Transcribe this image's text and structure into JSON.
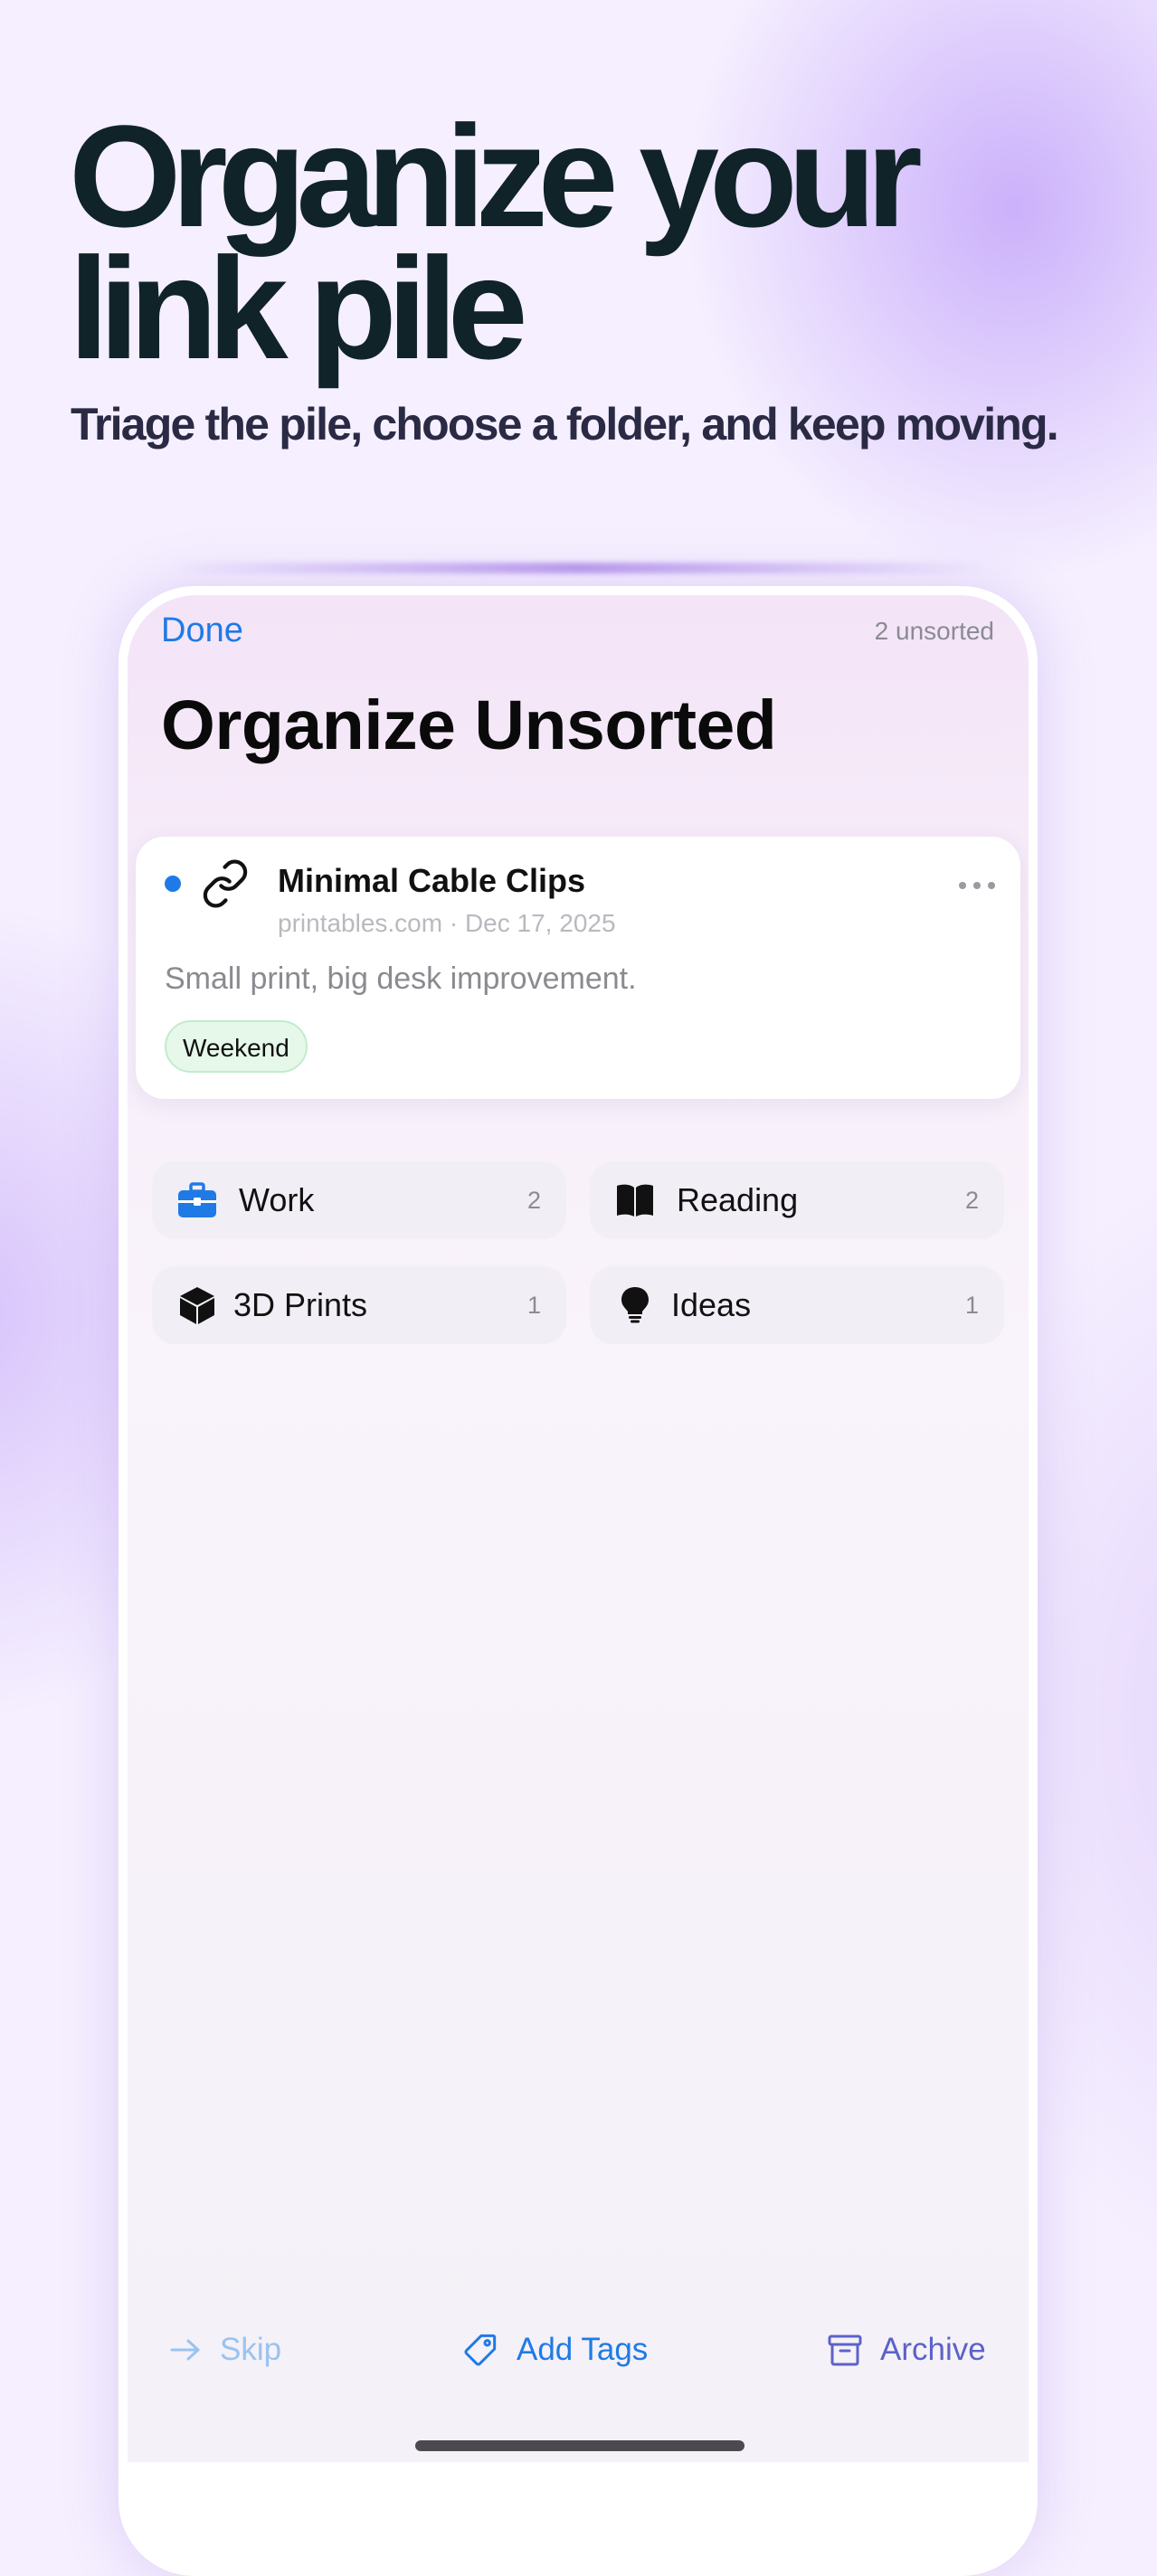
{
  "hero": {
    "headline": "Organize your link pile",
    "subheadline": "Triage the pile, choose a folder, and keep moving."
  },
  "screen": {
    "done_label": "Done",
    "unsorted_count": "2 unsorted",
    "title": "Organize Unsorted"
  },
  "link": {
    "title": "Minimal Cable Clips",
    "meta": "printables.com · Dec 17, 2025",
    "note": "Small print, big desk improvement.",
    "tag": "Weekend",
    "icon": "link-icon"
  },
  "folders": [
    {
      "name": "Work",
      "count": "2",
      "icon": "briefcase-icon",
      "color": "#1f7ae6"
    },
    {
      "name": "Reading",
      "count": "2",
      "icon": "book-icon",
      "color": "#111111"
    },
    {
      "name": "3D Prints",
      "count": "1",
      "icon": "cube-icon",
      "color": "#111111"
    },
    {
      "name": "Ideas",
      "count": "1",
      "icon": "lightbulb-icon",
      "color": "#111111"
    }
  ],
  "actions": {
    "skip": "Skip",
    "add_tags": "Add Tags",
    "archive": "Archive"
  },
  "colors": {
    "accent": "#1f7ae6",
    "archive": "#5d62c8",
    "headline": "#0f2328",
    "tag_bg": "#e6f8ea"
  }
}
